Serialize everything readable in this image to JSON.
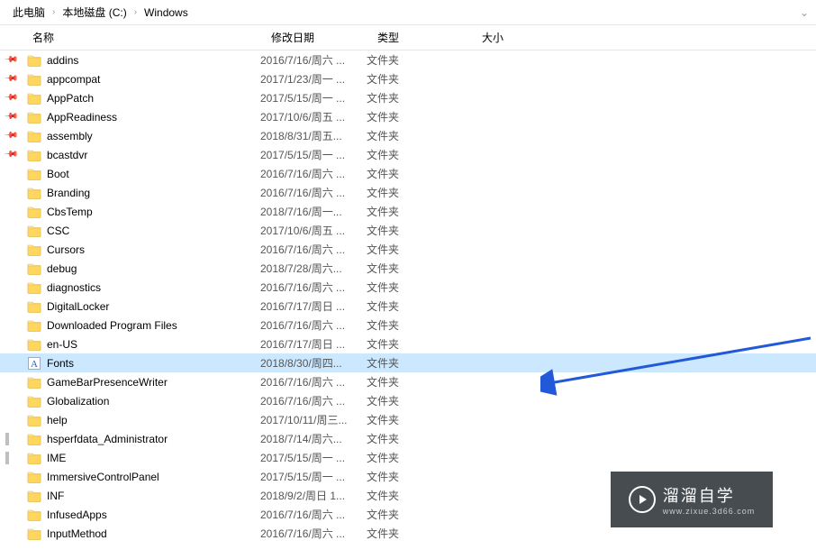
{
  "breadcrumb": {
    "items": [
      "此电脑",
      "本地磁盘 (C:)",
      "Windows"
    ]
  },
  "columns": {
    "name": "名称",
    "date": "修改日期",
    "type": "类型",
    "size": "大小"
  },
  "files": [
    {
      "name": "addins",
      "date": "2016/7/16/周六 ...",
      "type": "文件夹",
      "icon": "folder",
      "pin": true
    },
    {
      "name": "appcompat",
      "date": "2017/1/23/周一 ...",
      "type": "文件夹",
      "icon": "folder",
      "pin": true
    },
    {
      "name": "AppPatch",
      "date": "2017/5/15/周一 ...",
      "type": "文件夹",
      "icon": "folder",
      "pin": true
    },
    {
      "name": "AppReadiness",
      "date": "2017/10/6/周五 ...",
      "type": "文件夹",
      "icon": "folder",
      "pin": true
    },
    {
      "name": "assembly",
      "date": "2018/8/31/周五...",
      "type": "文件夹",
      "icon": "folder",
      "pin": true
    },
    {
      "name": "bcastdvr",
      "date": "2017/5/15/周一 ...",
      "type": "文件夹",
      "icon": "folder",
      "pin": true
    },
    {
      "name": "Boot",
      "date": "2016/7/16/周六 ...",
      "type": "文件夹",
      "icon": "folder"
    },
    {
      "name": "Branding",
      "date": "2016/7/16/周六 ...",
      "type": "文件夹",
      "icon": "folder"
    },
    {
      "name": "CbsTemp",
      "date": "2018/7/16/周一...",
      "type": "文件夹",
      "icon": "folder"
    },
    {
      "name": "CSC",
      "date": "2017/10/6/周五 ...",
      "type": "文件夹",
      "icon": "folder"
    },
    {
      "name": "Cursors",
      "date": "2016/7/16/周六 ...",
      "type": "文件夹",
      "icon": "folder"
    },
    {
      "name": "debug",
      "date": "2018/7/28/周六...",
      "type": "文件夹",
      "icon": "folder"
    },
    {
      "name": "diagnostics",
      "date": "2016/7/16/周六 ...",
      "type": "文件夹",
      "icon": "folder"
    },
    {
      "name": "DigitalLocker",
      "date": "2016/7/17/周日 ...",
      "type": "文件夹",
      "icon": "folder"
    },
    {
      "name": "Downloaded Program Files",
      "date": "2016/7/16/周六 ...",
      "type": "文件夹",
      "icon": "folder"
    },
    {
      "name": "en-US",
      "date": "2016/7/17/周日 ...",
      "type": "文件夹",
      "icon": "folder"
    },
    {
      "name": "Fonts",
      "date": "2018/8/30/周四...",
      "type": "文件夹",
      "icon": "font",
      "selected": true
    },
    {
      "name": "GameBarPresenceWriter",
      "date": "2016/7/16/周六 ...",
      "type": "文件夹",
      "icon": "folder"
    },
    {
      "name": "Globalization",
      "date": "2016/7/16/周六 ...",
      "type": "文件夹",
      "icon": "folder"
    },
    {
      "name": "help",
      "date": "2017/10/11/周三...",
      "type": "文件夹",
      "icon": "folder"
    },
    {
      "name": "hsperfdata_Administrator",
      "date": "2018/7/14/周六...",
      "type": "文件夹",
      "icon": "folder",
      "grey": true
    },
    {
      "name": "IME",
      "date": "2017/5/15/周一 ...",
      "type": "文件夹",
      "icon": "folder",
      "grey": true
    },
    {
      "name": "ImmersiveControlPanel",
      "date": "2017/5/15/周一 ...",
      "type": "文件夹",
      "icon": "folder"
    },
    {
      "name": "INF",
      "date": "2018/9/2/周日 1...",
      "type": "文件夹",
      "icon": "folder"
    },
    {
      "name": "InfusedApps",
      "date": "2016/7/16/周六 ...",
      "type": "文件夹",
      "icon": "folder"
    },
    {
      "name": "InputMethod",
      "date": "2016/7/16/周六 ...",
      "type": "文件夹",
      "icon": "folder"
    }
  ],
  "watermark": {
    "title": "溜溜自学",
    "url": "www.zixue.3d66.com"
  }
}
